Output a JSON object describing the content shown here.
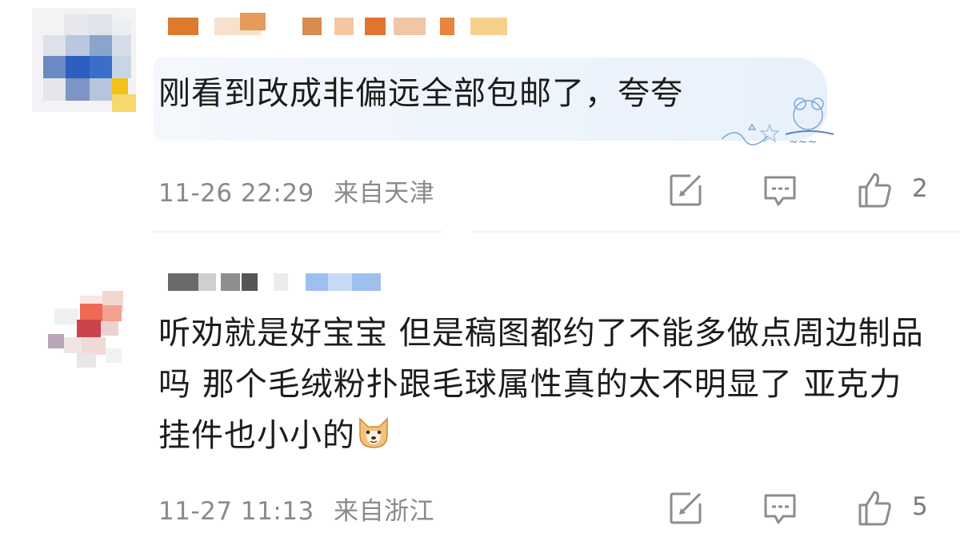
{
  "comments": [
    {
      "text": "刚看到改成非偏远全部包邮了，夸夸",
      "time": "11-26 22:29",
      "location": "来自天津",
      "likes": "2"
    },
    {
      "text": "听劝就是好宝宝 但是稿图都约了不能多做点周边制品吗 那个毛绒粉扑跟毛球属性真的太不明显了 亚克力挂件也小小的",
      "time": "11-27 11:13",
      "location": "来自浙江",
      "likes": "5"
    }
  ],
  "colors": {
    "text": "#1c1c1c",
    "meta": "#8a8a8a",
    "icon": "#8c8c8c",
    "bubble": "#e8f1fb"
  },
  "icons": [
    "repost-icon",
    "comment-icon",
    "like-icon",
    "dog-emoji-icon"
  ]
}
